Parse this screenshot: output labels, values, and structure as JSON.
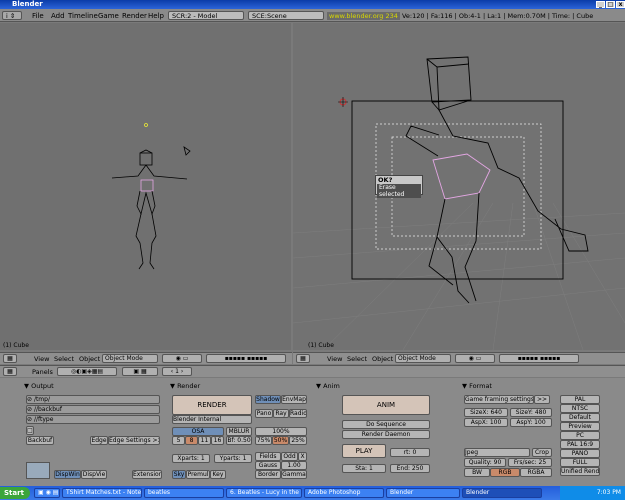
{
  "window": {
    "title": "Blender"
  },
  "menubar": {
    "menus": [
      "File",
      "Add",
      "Timeline",
      "Game",
      "Render",
      "Help"
    ],
    "screen": "SCR:2 - Model",
    "scene": "SCE:Scene",
    "info_link": "www.blender.org 234",
    "info_stats": "Ve:120 | Fa:116 | Ob:4-1 | La:1 | Mem:0.70M | Time: | Cube"
  },
  "viewport_left": {
    "label": "(1) Cube"
  },
  "viewport_right": {
    "label": "(1) Cube",
    "popup": {
      "title": "OK?",
      "item": "Erase selected"
    }
  },
  "header_left": {
    "view": "View",
    "select": "Select",
    "object": "Object",
    "mode": "Object Mode"
  },
  "header_right": {
    "view": "View",
    "select": "Select",
    "object": "Object",
    "mode": "Object Mode"
  },
  "buttons_header": {
    "panels": "Panels",
    "frame": "1"
  },
  "output": {
    "title": "Output",
    "paths": [
      "/tmp/",
      "//backbuf",
      "//ftype"
    ],
    "backbuf": "Backbuf",
    "edge": "Edge",
    "edge_settings": "Edge Settings >>",
    "dispwin": "DispWin",
    "dispview": "DispVie",
    "extensions": "Extension"
  },
  "render": {
    "title": "Render",
    "render_btn": "RENDER",
    "renderer": "Blender Internal",
    "shadow": "Shadow",
    "envmap": "EnvMap",
    "pano": "Pano",
    "ray": "Ray",
    "radio": "Radio",
    "osa": "OSA",
    "mblur": "MBLUR",
    "osa_levels": [
      "5",
      "8",
      "11",
      "16"
    ],
    "bf": "Bf: 0.50",
    "pct_100": "100%",
    "pct": [
      "75%",
      "50%",
      "25%"
    ],
    "xparts": "Xparts: 1",
    "yparts": "Yparts: 1",
    "fields": "Fields",
    "odd": "Odd",
    "x": "X",
    "gauss": "Gauss",
    "gauss_val": "1.00",
    "sky": "Sky",
    "premul": "Premul",
    "key": "Key",
    "border": "Border",
    "gamma": "Gamma"
  },
  "anim": {
    "title": "Anim",
    "anim_btn": "ANIM",
    "do_sequence": "Do Sequence",
    "render_daemon": "Render Daemon",
    "play": "PLAY",
    "rt": "rt: 0",
    "sta": "Sta: 1",
    "end": "End: 250"
  },
  "format": {
    "title": "Format",
    "game_framing": "Game framing settings",
    "arrows": ">>",
    "sizex": "SizeX: 640",
    "sizey": "SizeY: 480",
    "aspx": "AspX: 100",
    "aspy": "AspY: 100",
    "codec": "Jpeg",
    "crop": "Crop",
    "quality": "Quality: 90",
    "fps": "Frs/sec: 25",
    "bw": "BW",
    "rgb": "RGB",
    "rgba": "RGBA",
    "presets": [
      "PAL",
      "NTSC",
      "Default",
      "Preview",
      "PC",
      "PAL 16:9",
      "PANO",
      "FULL",
      "Unified Rende"
    ]
  },
  "taskbar": {
    "start": "Start",
    "tasks": [
      "TShirt Matches.txt - Note...",
      "beatles",
      "6. Beatles - Lucy in the sk...",
      "Adobe Photoshop",
      "Blender",
      "Blender"
    ],
    "clock": "7:03 PM"
  },
  "colors": {
    "selected": "#e3a6e3",
    "wire": "#000000",
    "grid": "#7e7e7e"
  }
}
